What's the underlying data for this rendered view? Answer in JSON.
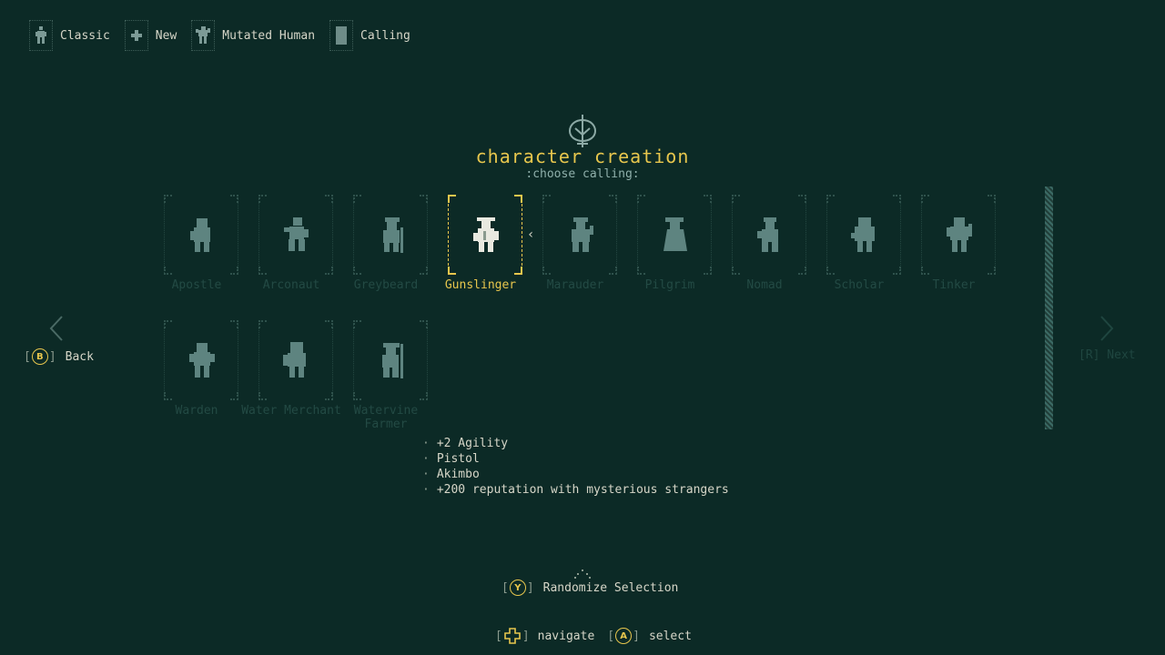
{
  "breadcrumbs": [
    {
      "label": "Classic",
      "icon": "classic-figure-icon"
    },
    {
      "label": "New",
      "icon": "plus-tile-icon"
    },
    {
      "label": "Mutated Human",
      "icon": "mutant-figure-icon"
    },
    {
      "label": "Calling",
      "icon": "calling-card-icon"
    }
  ],
  "header": {
    "title": "character creation",
    "subtitle": ":choose calling:"
  },
  "callings": [
    {
      "label": "Apostle",
      "icon": "apostle-sprite-icon"
    },
    {
      "label": "Arconaut",
      "icon": "arconaut-sprite-icon"
    },
    {
      "label": "Greybeard",
      "icon": "greybeard-sprite-icon"
    },
    {
      "label": "Gunslinger",
      "icon": "gunslinger-sprite-icon",
      "selected": true
    },
    {
      "label": "Marauder",
      "icon": "marauder-sprite-icon"
    },
    {
      "label": "Pilgrim",
      "icon": "pilgrim-sprite-icon"
    },
    {
      "label": "Nomad",
      "icon": "nomad-sprite-icon"
    },
    {
      "label": "Scholar",
      "icon": "scholar-sprite-icon"
    },
    {
      "label": "Tinker",
      "icon": "tinker-sprite-icon"
    },
    {
      "label": "Warden",
      "icon": "warden-sprite-icon"
    },
    {
      "label": "Water Merchant",
      "icon": "water-merchant-sprite-icon"
    },
    {
      "label": "Watervine Farmer",
      "icon": "watervine-farmer-sprite-icon"
    }
  ],
  "selection_caret": "‹",
  "bonuses": [
    "+2 Agility",
    "Pistol",
    "Akimbo",
    "+200 reputation with mysterious strangers"
  ],
  "nav": {
    "back_key": "B",
    "back_label": "Back",
    "next_label": "[R] Next"
  },
  "randomize": {
    "key": "Y",
    "label": "Randomize Selection"
  },
  "hints": {
    "navigate_label": "navigate",
    "select_key": "A",
    "select_label": "select"
  },
  "colors": {
    "background": "#0c2a26",
    "accent": "#e7c64d",
    "text": "#d6d6c8",
    "dim": "#234a44",
    "sprite": "#5e8480"
  }
}
